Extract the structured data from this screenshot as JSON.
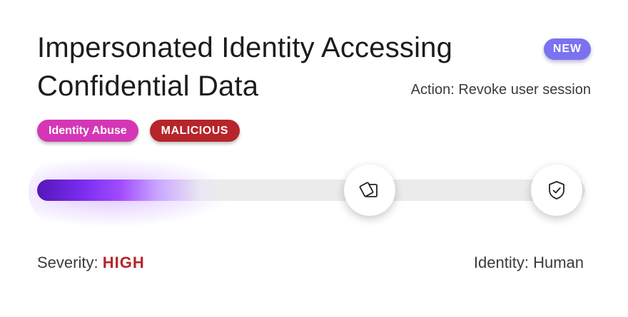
{
  "alert": {
    "title_line1": "Impersonated Identity Accessing",
    "title_line2": "Confidential Data",
    "badge": "NEW",
    "action": "Action: Revoke user session"
  },
  "tags": [
    {
      "label": "Identity Abuse",
      "color": "#d436b6"
    },
    {
      "label": "MALICIOUS",
      "color": "#b52529"
    }
  ],
  "progress": {
    "fill_fraction": 0.34,
    "accent_color": "#7a2df0",
    "nodes": [
      {
        "icon": "cards-icon"
      },
      {
        "icon": "shield-check-icon"
      }
    ]
  },
  "footer": {
    "severity_label": "Severity:",
    "severity_value": "HIGH",
    "identity": "Identity: Human"
  }
}
